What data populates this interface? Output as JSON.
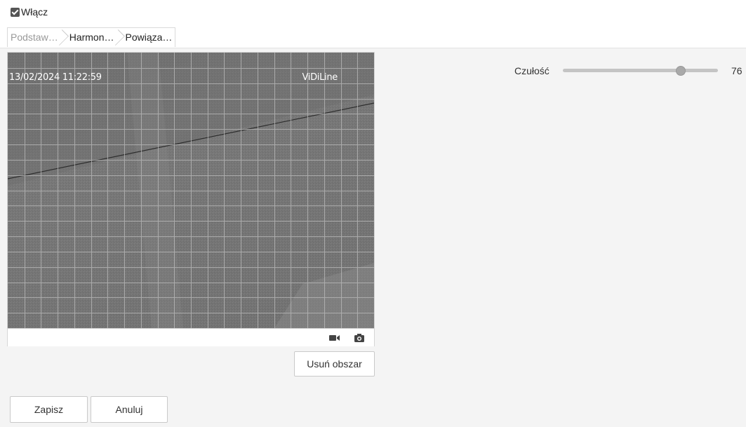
{
  "enable": {
    "label": "Włącz",
    "checked": true
  },
  "tabs": [
    {
      "label": "Podstaw…",
      "active": true
    },
    {
      "label": "Harmon…",
      "active": false
    },
    {
      "label": "Powiąza…",
      "active": false
    }
  ],
  "video": {
    "timestamp": "13/02/2024 11:22:59",
    "camera_name": "ViDiLine",
    "icons": [
      "video-camera-icon",
      "snapshot-camera-icon"
    ]
  },
  "buttons": {
    "remove_area": "Usuń obszar",
    "save": "Zapisz",
    "cancel": "Anuluj"
  },
  "sensitivity": {
    "label": "Czułość",
    "value": "76",
    "fraction": 0.76
  },
  "colors": {
    "background": "#f4f4f4",
    "grid": "#b8b8b8",
    "slider_track": "#c4c4c4"
  }
}
